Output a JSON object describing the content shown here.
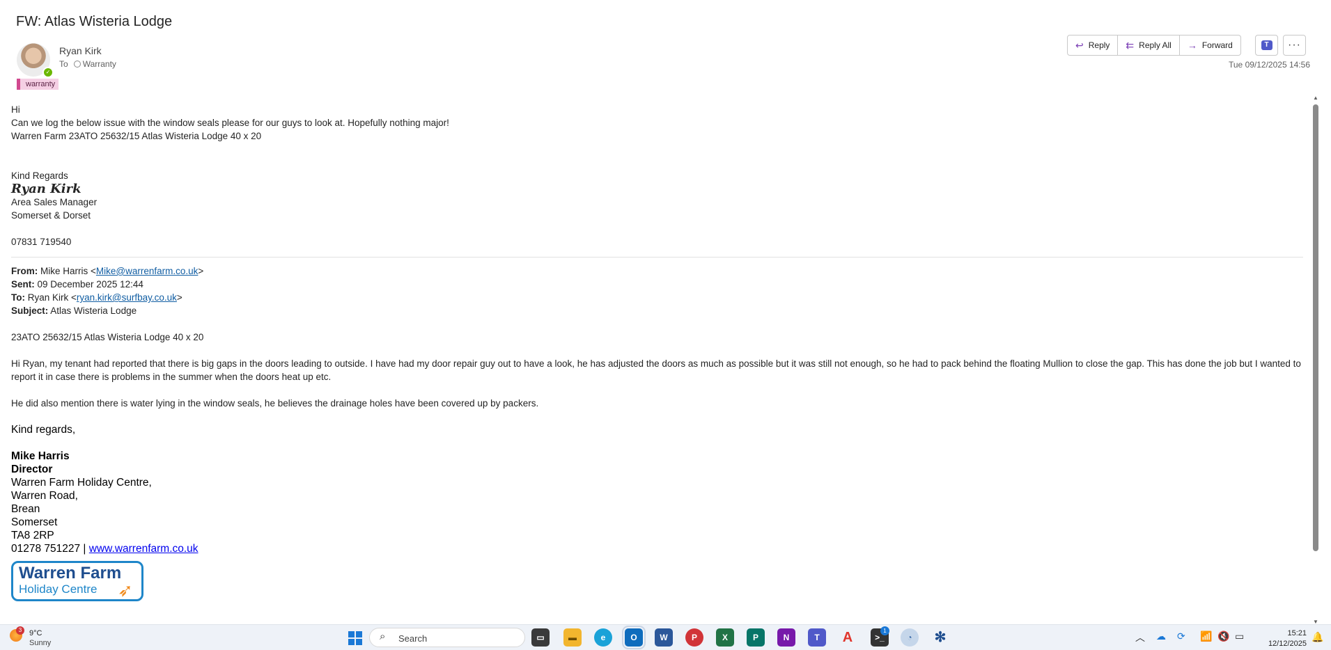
{
  "header": {
    "subject": "FW: Atlas Wisteria Lodge",
    "sender": "Ryan Kirk",
    "to_label": "To",
    "to_value": "Warranty",
    "category_tag": "warranty",
    "timestamp": "Tue 09/12/2025 14:56"
  },
  "actions": {
    "reply": "Reply",
    "reply_all": "Reply All",
    "forward": "Forward"
  },
  "body": {
    "greeting": "Hi",
    "line1": "Can we log the below issue with the window seals please for our guys to look at. Hopefully nothing major!",
    "line2": "Warren Farm 23ATO 25632/15 Atlas Wisteria Lodge 40 x 20",
    "regards": "Kind Regards",
    "sig_name": "Ryan Kirk",
    "sig_title": "Area Sales Manager",
    "sig_area": "Somerset & Dorset",
    "sig_phone": "07831 719540"
  },
  "forwarded": {
    "from_label": "From:",
    "from_name": "Mike Harris <",
    "from_email": "Mike@warrenfarm.co.uk",
    "close": ">",
    "sent_label": "Sent:",
    "sent_value": "09 December 2025 12:44",
    "to_label": "To:",
    "to_name": "Ryan Kirk <",
    "to_email": "ryan.kirk@surfbay.co.uk",
    "subject_label": "Subject:",
    "subject_value": "Atlas Wisteria Lodge",
    "ref": "23ATO 25632/15 Atlas Wisteria Lodge 40 x 20",
    "para1": "Hi Ryan, my tenant had reported that there is big gaps in the doors leading to outside. I have had my door repair guy out to have a look, he has adjusted the doors as much as possible but it was still not enough, so he had to pack behind the floating Mullion to close the gap. This has done the job but I wanted to report it in case there is problems in the summer when the doors heat up etc.",
    "para2": "He did also mention there is water lying in the window seals, he believes the drainage holes have been covered up by packers.",
    "regards": "Kind regards,",
    "sig_name": "Mike Harris",
    "sig_role": "Director",
    "addr1": "Warren Farm Holiday Centre,",
    "addr2": "Warren Road,",
    "addr3": "Brean",
    "addr4": "Somerset",
    "addr5": "TA8 2RP",
    "phone": "01278 751227 | ",
    "website": "www.warrenfarm.co.uk",
    "logo_line1": "Warren Farm",
    "logo_line2": "Holiday Centre"
  },
  "taskbar": {
    "weather_temp": "9°C",
    "weather_cond": "Sunny",
    "weather_badge": "3",
    "search_placeholder": "Search",
    "app_badge": "1",
    "time": "15:21",
    "date": "12/12/2025"
  },
  "icons": {
    "reply": "reply-arrow-icon",
    "reply_all": "reply-all-arrow-icon",
    "forward": "forward-arrow-icon",
    "more": "more-dots-icon",
    "teams": "teams-icon"
  },
  "colors": {
    "accent_purple": "#7b3fb5",
    "tag_pink": "#d1498f",
    "link_blue": "#115ea3",
    "presence_green": "#6bb700"
  }
}
